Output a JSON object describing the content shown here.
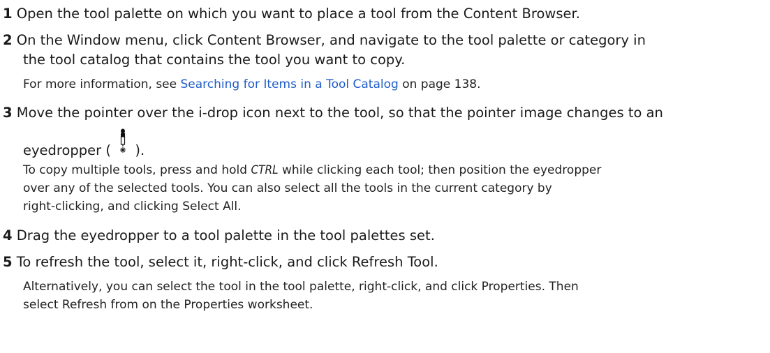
{
  "steps": [
    {
      "num": "1",
      "text": "Open the tool palette on which you want to place a tool from the Content Browser."
    },
    {
      "num": "2",
      "line1": "On the Window menu, click Content Browser, and navigate to the tool palette or category in",
      "line2": "the tool catalog that contains the tool you want to copy."
    },
    {
      "num": "3",
      "line1": "Move the pointer over the i-drop icon next to the tool, so that the pointer image changes to an",
      "line2_before": "eyedropper (",
      "line2_after": ")."
    },
    {
      "num": "4",
      "text": "Drag the eyedropper to a tool palette in the tool palettes set."
    },
    {
      "num": "5",
      "text": "To refresh the tool, select it, right-click, and click Refresh Tool."
    }
  ],
  "step2_note": {
    "before": "For more information, see ",
    "link": "Searching for Items in a Tool Catalog",
    "after": " on page 138."
  },
  "step3_note": {
    "line1_before": "To copy multiple tools, press and hold ",
    "key": "CTRL",
    "line1_after": " while clicking each tool; then position the eyedropper",
    "line2": "over any of the selected tools. You can also select all the tools in the current category by",
    "line3": "right-clicking, and clicking Select All."
  },
  "step5_note": {
    "line1": "Alternatively, you can select the tool in the tool palette, right-click, and click Properties. Then",
    "line2": "select Refresh from on the Properties worksheet."
  },
  "colors": {
    "link": "#1f5cc8",
    "text": "#1a1a1a"
  },
  "icons": {
    "eyedropper": "eyedropper-icon"
  }
}
